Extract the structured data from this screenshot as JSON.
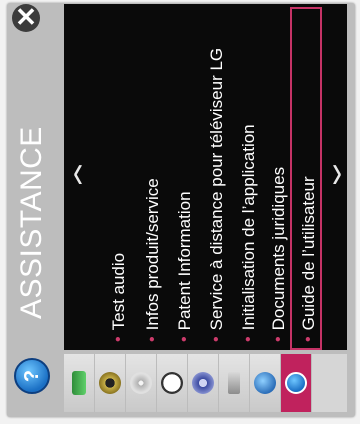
{
  "sidebar": {
    "title": "ASSISTANCE",
    "close_glyph": "✕",
    "help_glyph": "?"
  },
  "navigation": {
    "prev_glyph": "‹",
    "next_glyph": "›"
  },
  "menu": {
    "items": [
      {
        "label": "Test audio"
      },
      {
        "label": "Infos produit/service"
      },
      {
        "label": "Patent Information"
      },
      {
        "label": "Service à distance pour téléviseur LG"
      },
      {
        "label": "Initialisation de l’application"
      },
      {
        "label": "Documents juridiques"
      },
      {
        "label": "Guide de l’utilisateur",
        "selected": true
      }
    ]
  },
  "bottom_icons": [
    {
      "name": "battery-icon",
      "color": "#3aa845"
    },
    {
      "name": "speaker-icon",
      "color": "#b8a030"
    },
    {
      "name": "disc-icon",
      "color": "#9a9a9a"
    },
    {
      "name": "clock-icon",
      "color": "#444444"
    },
    {
      "name": "media-icon",
      "color": "#3b4aa0"
    },
    {
      "name": "lock-icon",
      "color": "#7a7a7a"
    },
    {
      "name": "globe-icon",
      "color": "#2a6db8"
    },
    {
      "name": "support-icon",
      "color": "#1a6fc4",
      "active": true
    }
  ],
  "colors": {
    "accent": "#c0225d",
    "highlight_border": "#c63366",
    "panel_bg": "#0a0a0a"
  }
}
